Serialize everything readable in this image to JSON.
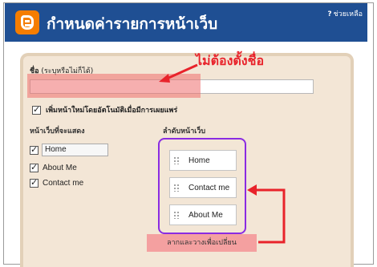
{
  "header": {
    "title": "กำหนดค่ารายการหน้าเว็บ",
    "help_icon": "?",
    "help_label": "ช่วยเหลือ",
    "bg_color": "#1f4f93"
  },
  "logo": {
    "icon": "blogger-logo-icon",
    "color": "#f57d00"
  },
  "form": {
    "name_label_strong": "ชื่อ",
    "name_label_hint": "(ระบุหรือไม่ก็ได้)",
    "name_value": "",
    "auto_add_label": "เพิ่มหน้าใหม่โดยอัตโนมัติเมื่อมีการเผยแพร่",
    "auto_add_checked": true,
    "show_heading": "หน้าเว็บที่จะแสดง",
    "order_heading": "ลำดับหน้าเว็บ",
    "pages_to_show": [
      {
        "label": "Home",
        "checked": true
      },
      {
        "label": "About Me",
        "checked": true
      },
      {
        "label": "Contact me",
        "checked": true
      }
    ],
    "page_order": [
      "Home",
      "Contact me",
      "About Me"
    ],
    "drag_hint": "ลากและวางเพื่อเปลี่ยน"
  },
  "annotations": {
    "no_name_needed": "ไม่ต้องตั้งชื่อ",
    "color": "#e8232b",
    "highlight_color": "#f4a0a0",
    "box_color": "#8a2be2"
  }
}
